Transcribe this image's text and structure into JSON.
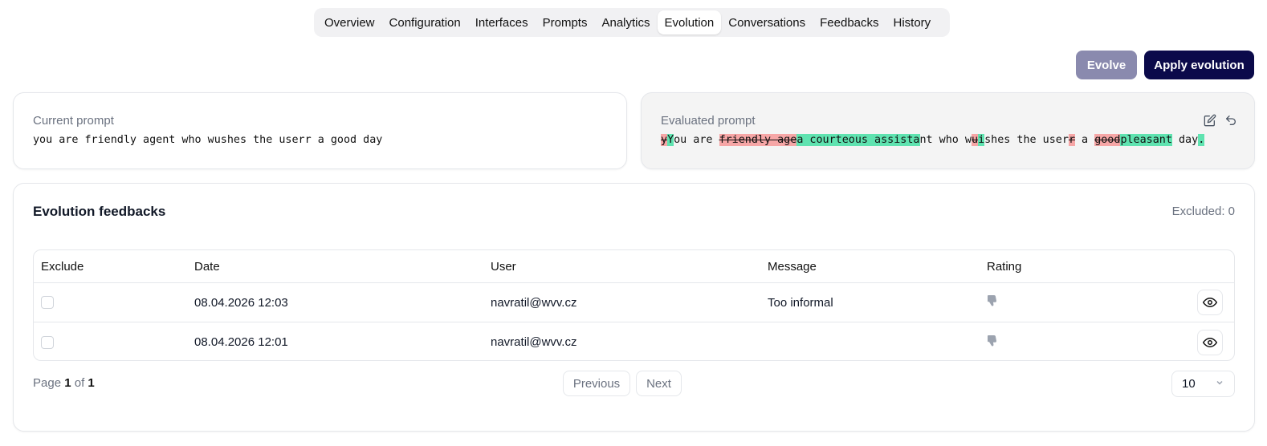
{
  "tabs": [
    {
      "label": "Overview",
      "active": false
    },
    {
      "label": "Configuration",
      "active": false
    },
    {
      "label": "Interfaces",
      "active": false
    },
    {
      "label": "Prompts",
      "active": false
    },
    {
      "label": "Analytics",
      "active": false
    },
    {
      "label": "Evolution",
      "active": true
    },
    {
      "label": "Conversations",
      "active": false
    },
    {
      "label": "Feedbacks",
      "active": false
    },
    {
      "label": "History",
      "active": false
    }
  ],
  "actions": {
    "evolve_label": "Evolve",
    "apply_label": "Apply evolution"
  },
  "current_prompt": {
    "label": "Current prompt",
    "text": "you are friendly agent who wushes the userr a good day"
  },
  "evaluated_prompt": {
    "label": "Evaluated prompt",
    "diff": [
      {
        "t": "del",
        "s": "y"
      },
      {
        "t": "ins",
        "s": "Y"
      },
      {
        "t": "eq",
        "s": "ou are "
      },
      {
        "t": "del",
        "s": "friendly age"
      },
      {
        "t": "ins",
        "s": "a courteous assista"
      },
      {
        "t": "eq",
        "s": "nt who w"
      },
      {
        "t": "del",
        "s": "u"
      },
      {
        "t": "ins",
        "s": "i"
      },
      {
        "t": "eq",
        "s": "shes the user"
      },
      {
        "t": "del",
        "s": "r"
      },
      {
        "t": "eq",
        "s": " a "
      },
      {
        "t": "del",
        "s": "good"
      },
      {
        "t": "ins",
        "s": "pleasant"
      },
      {
        "t": "eq",
        "s": " day"
      },
      {
        "t": "ins",
        "s": "."
      }
    ],
    "icons": [
      "edit-icon",
      "undo-icon"
    ]
  },
  "feedbacks": {
    "title": "Evolution feedbacks",
    "excluded_text": "Excluded: 0",
    "columns": {
      "exclude": "Exclude",
      "date": "Date",
      "user": "User",
      "message": "Message",
      "rating": "Rating"
    },
    "rows": [
      {
        "date": "08.04.2026 12:03",
        "user": "navratil@wvv.cz",
        "message": "Too informal",
        "rating": "thumbs-down",
        "excluded": false
      },
      {
        "date": "08.04.2026 12:01",
        "user": "navratil@wvv.cz",
        "message": "",
        "rating": "thumbs-down",
        "excluded": false
      }
    ]
  },
  "pagination": {
    "page_prefix": "Page",
    "current": "1",
    "of": "of",
    "total": "1",
    "previous_label": "Previous",
    "next_label": "Next",
    "page_size": "10"
  },
  "colors": {
    "apply_button": "#0b0a4a",
    "evolve_button": "#8a8aae",
    "diff_deleted": "#f6a6a6",
    "diff_inserted": "#5fe3b0"
  }
}
